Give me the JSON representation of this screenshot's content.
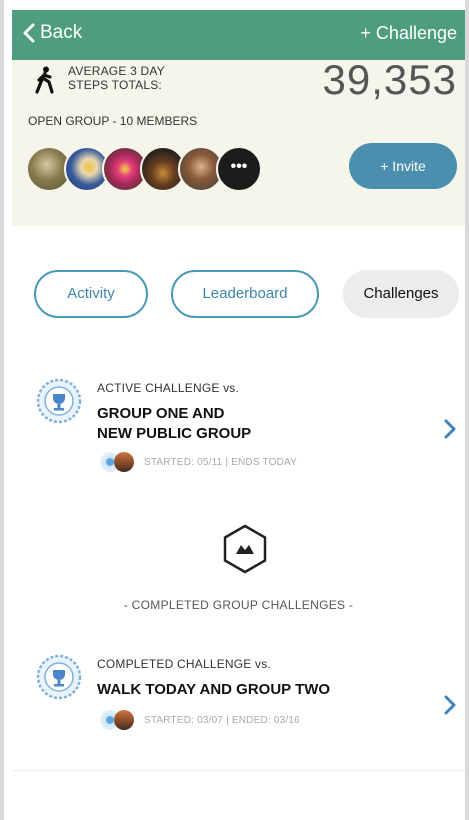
{
  "nav": {
    "back_label": "Back",
    "add_challenge_label": "+ Challenge"
  },
  "header": {
    "avg_label_line1": "AVERAGE 3 DAY",
    "avg_label_line2": "STEPS TOTALS:",
    "steps_total": "39,353",
    "group_info": "OPEN GROUP - 10 MEMBERS",
    "more_label": "•••",
    "invite_label": "+ Invite"
  },
  "tabs": [
    {
      "label": "Activity",
      "selected": false
    },
    {
      "label": "Leaderboard",
      "selected": false
    },
    {
      "label": "Challenges",
      "selected": true
    }
  ],
  "active_challenge": {
    "type": "ACTIVE CHALLENGE vs.",
    "title_line1": "GROUP ONE AND",
    "title_line2": "NEW PUBLIC GROUP",
    "dates": "STARTED: 05/11 | ENDS TODAY"
  },
  "completed_header": "- COMPLETED GROUP CHALLENGES -",
  "completed_challenge": {
    "type": "COMPLETED CHALLENGE vs.",
    "title_line1": "WALK TODAY AND GROUP TWO",
    "dates": "STARTED: 03/07 | ENDED: 03/16"
  },
  "colors": {
    "nav_bg": "#4f9d7f",
    "accent_blue": "#4a8fad",
    "header_bg": "#f6f5ec"
  },
  "icons": [
    "chevron-left-icon",
    "walking-person-icon",
    "trophy-badge-icon",
    "chevron-right-icon",
    "flags-hexagon-icon"
  ]
}
